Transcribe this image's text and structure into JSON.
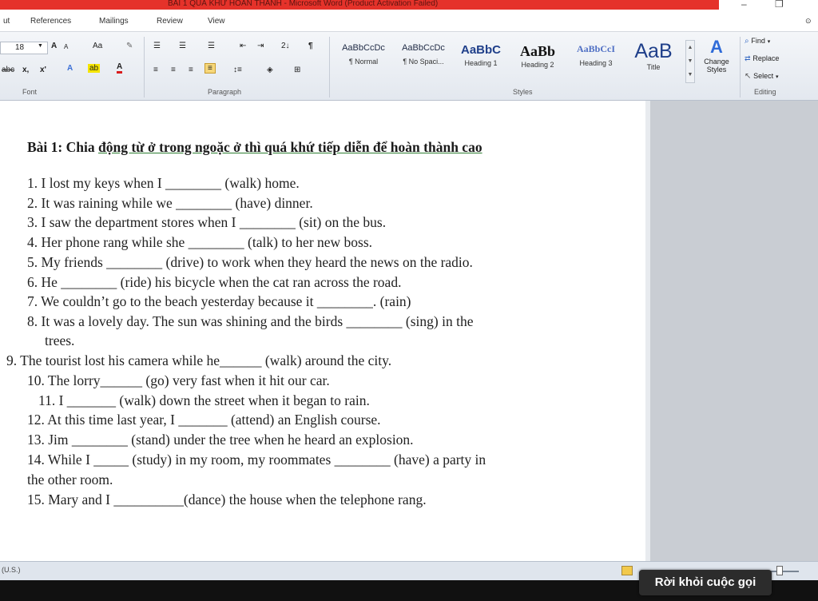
{
  "window": {
    "title": "BÀI 1 QUÁ KHỨ HOÀN THÀNH - Microsoft Word (Product Activation Failed)",
    "minimize": "–",
    "restore": "❐"
  },
  "tabs": [
    "ut",
    "References",
    "Mailings",
    "Review",
    "View"
  ],
  "ribbon": {
    "font": {
      "size": "18",
      "grow": "A",
      "shrink": "A",
      "case": "Aa",
      "strike": "abc",
      "subscript": "x,",
      "superscript": "x'",
      "label": "Font"
    },
    "paragraph": {
      "sort": "2↓",
      "pilcrow": "¶",
      "label": "Paragraph"
    },
    "styles": {
      "items": [
        {
          "sample": "AaBbCcDc",
          "name": "¶ Normal"
        },
        {
          "sample": "AaBbCcDc",
          "name": "¶ No Spaci..."
        },
        {
          "sample": "AaBbC",
          "name": "Heading 1"
        },
        {
          "sample": "AaBb",
          "name": "Heading 2"
        },
        {
          "sample": "AaBbCcI",
          "name": "Heading 3"
        },
        {
          "sample": "AaB",
          "name": "Title"
        }
      ],
      "change_styles": "Change Styles",
      "label": "Styles"
    },
    "editing": {
      "find": "Find",
      "replace": "Replace",
      "select": "Select",
      "label": "Editing"
    }
  },
  "document": {
    "heading": {
      "prefix": "Bài 1: Chia ",
      "underlined": "động từ ở trong ngoặc ở thì quá khứ tiếp diễn để hoàn thành cao"
    },
    "questions": [
      "1. I lost my keys when I ________ (walk) home.",
      "2. It was raining while we ________ (have) dinner.",
      "3. I saw the department stores when I ________ (sit) on the bus.",
      "4. Her phone rang while she ________ (talk) to her new boss.",
      "5. My friends ________ (drive) to work when they heard the news on the radio.",
      "6. He ________ (ride) his bicycle when the cat ran across the road.",
      "7. We couldn’t go to the beach yesterday because it ________. (rain)",
      "8. It was a lovely day. The sun was shining and the birds ________ (sing) in the",
      "trees.",
      "9. The tourist lost his camera while he______ (walk) around the city.",
      "10. The lorry______ (go) very fast when it hit our car.",
      "11. I _______ (walk) down the street when it began to rain.",
      "12. At this time last year, I _______ (attend) an English course.",
      "13. Jim ________ (stand) under the tree when he heard an explosion.",
      "14. While I _____ (study) in my room, my roommates ________ (have) a party in",
      "the other room.",
      "15. Mary and I __________(dance) the house when the telephone rang."
    ]
  },
  "statusbar": {
    "language": "(U.S.)"
  },
  "call": {
    "leave_label": "Rời khỏi cuộc gọi"
  }
}
